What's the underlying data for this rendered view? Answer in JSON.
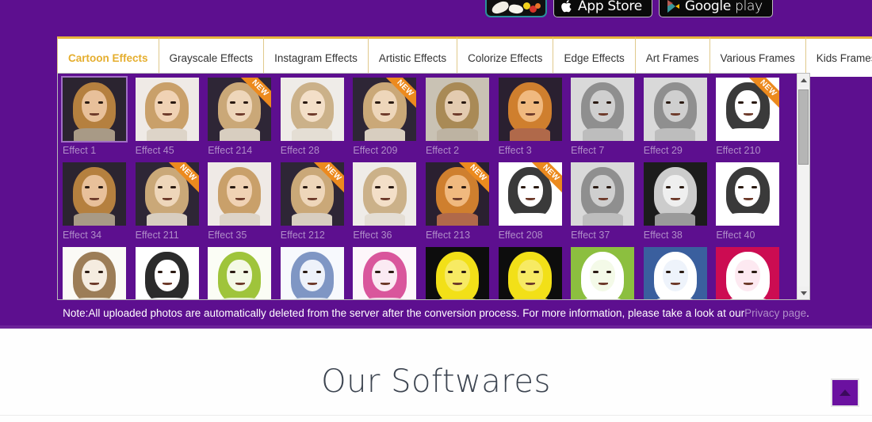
{
  "theme": {
    "purple": "#5d0f8f",
    "gold": "#e5ae2e",
    "ribbon_orange": "#ec8a1e",
    "caption_color": "#b08dc9"
  },
  "badges": {
    "app_icon_name": "app-logo-icon",
    "app_store_label": "App Store",
    "app_store_glyph": "apple-icon",
    "google_play_label_bold": "Google",
    "google_play_label_thin": " play",
    "google_play_glyph": "google-play-icon"
  },
  "tabs": [
    {
      "label": "Cartoon Effects",
      "active": true
    },
    {
      "label": "Grayscale Effects",
      "active": false
    },
    {
      "label": "Instagram Effects",
      "active": false
    },
    {
      "label": "Artistic Effects",
      "active": false
    },
    {
      "label": "Colorize Effects",
      "active": false
    },
    {
      "label": "Edge Effects",
      "active": false
    },
    {
      "label": "Art Frames",
      "active": false
    },
    {
      "label": "Various Frames",
      "active": false
    },
    {
      "label": "Kids Frames",
      "active": false
    }
  ],
  "effects": [
    {
      "label": "Effect 1",
      "new": false,
      "selected": true,
      "style": "cartoon-warm"
    },
    {
      "label": "Effect 45",
      "new": false,
      "selected": false,
      "style": "cartoon-light"
    },
    {
      "label": "Effect 214",
      "new": true,
      "selected": false,
      "style": "cartoon-sketchcolor"
    },
    {
      "label": "Effect 28",
      "new": false,
      "selected": false,
      "style": "cartoon-pale"
    },
    {
      "label": "Effect 209",
      "new": true,
      "selected": false,
      "style": "cartoon-sketchcolor"
    },
    {
      "label": "Effect 2",
      "new": false,
      "selected": false,
      "style": "cartoon-flat"
    },
    {
      "label": "Effect 3",
      "new": false,
      "selected": false,
      "style": "cartoon-vivid"
    },
    {
      "label": "Effect 7",
      "new": false,
      "selected": false,
      "style": "cartoon-gray"
    },
    {
      "label": "Effect 29",
      "new": false,
      "selected": false,
      "style": "cartoon-gray"
    },
    {
      "label": "Effect 210",
      "new": true,
      "selected": false,
      "style": "cartoon-lineart"
    },
    {
      "label": "Effect 34",
      "new": false,
      "selected": false,
      "style": "cartoon-warm"
    },
    {
      "label": "Effect 211",
      "new": true,
      "selected": false,
      "style": "cartoon-sketchcolor"
    },
    {
      "label": "Effect 35",
      "new": false,
      "selected": false,
      "style": "cartoon-light"
    },
    {
      "label": "Effect 212",
      "new": true,
      "selected": false,
      "style": "cartoon-sketchcolor"
    },
    {
      "label": "Effect 36",
      "new": false,
      "selected": false,
      "style": "cartoon-pale"
    },
    {
      "label": "Effect 213",
      "new": true,
      "selected": false,
      "style": "cartoon-vivid"
    },
    {
      "label": "Effect 208",
      "new": true,
      "selected": false,
      "style": "cartoon-lineart"
    },
    {
      "label": "Effect 37",
      "new": false,
      "selected": false,
      "style": "cartoon-gray"
    },
    {
      "label": "Effect 38",
      "new": false,
      "selected": false,
      "style": "cartoon-grayhigh"
    },
    {
      "label": "Effect 40",
      "new": false,
      "selected": false,
      "style": "cartoon-lineart"
    },
    {
      "label": "",
      "new": false,
      "selected": false,
      "style": "sketch-sepia"
    },
    {
      "label": "",
      "new": false,
      "selected": false,
      "style": "sketch-black"
    },
    {
      "label": "",
      "new": false,
      "selected": false,
      "style": "sketch-green"
    },
    {
      "label": "",
      "new": false,
      "selected": false,
      "style": "sketch-blue"
    },
    {
      "label": "",
      "new": false,
      "selected": false,
      "style": "sketch-pink"
    },
    {
      "label": "",
      "new": false,
      "selected": false,
      "style": "pop-yellow"
    },
    {
      "label": "",
      "new": false,
      "selected": false,
      "style": "pop-yellow"
    },
    {
      "label": "",
      "new": false,
      "selected": false,
      "style": "pop-green"
    },
    {
      "label": "",
      "new": false,
      "selected": false,
      "style": "pop-blue"
    },
    {
      "label": "",
      "new": false,
      "selected": false,
      "style": "pop-magenta"
    }
  ],
  "ribbon_text": "NEW",
  "note": {
    "prefix": "Note:",
    "body": " All uploaded photos are automatically deleted from the server after the conversion process. For more information, please take a look at our ",
    "link": "Privacy page",
    "suffix": "."
  },
  "softwares": {
    "title": "Our Softwares"
  },
  "back_to_top": {
    "icon": "chevron-up-icon"
  },
  "scrollbar": {
    "up_icon": "scroll-up-arrow-icon",
    "down_icon": "scroll-down-arrow-icon"
  }
}
